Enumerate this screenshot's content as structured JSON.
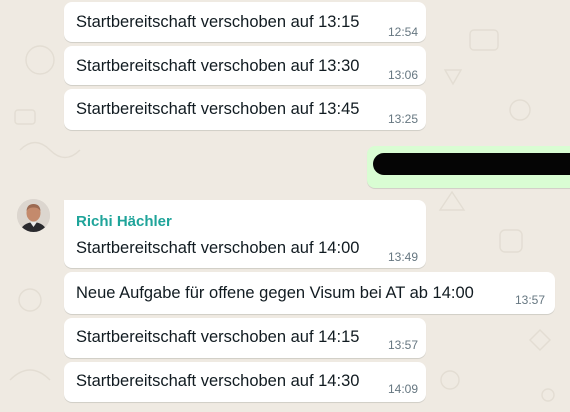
{
  "chat": {
    "messages": [
      {
        "text": "Startbereitschaft verschoben auf 13:15",
        "time": "12:54"
      },
      {
        "text": "Startbereitschaft verschoben auf 13:30",
        "time": "13:06"
      },
      {
        "text": "Startbereitschaft verschoben auf 13:45",
        "time": "13:25"
      },
      {
        "sender": "Richi Hächler",
        "text": "Startbereitschaft verschoben auf 14:00",
        "time": "13:49"
      },
      {
        "text": "Neue Aufgabe für offene gegen Visum bei AT ab 14:00",
        "time": "13:57"
      },
      {
        "text": "Startbereitschaft verschoben auf 14:15",
        "time": "13:57"
      },
      {
        "text": "Startbereitschaft verschoben auf 14:30",
        "time": "14:09"
      }
    ]
  },
  "colors": {
    "chat_background": "#efeae2",
    "incoming_bubble": "#ffffff",
    "outgoing_bubble": "#d9fdd3",
    "sender_name": "#1fa49a",
    "timestamp": "#667781",
    "message_text": "#111b21"
  }
}
